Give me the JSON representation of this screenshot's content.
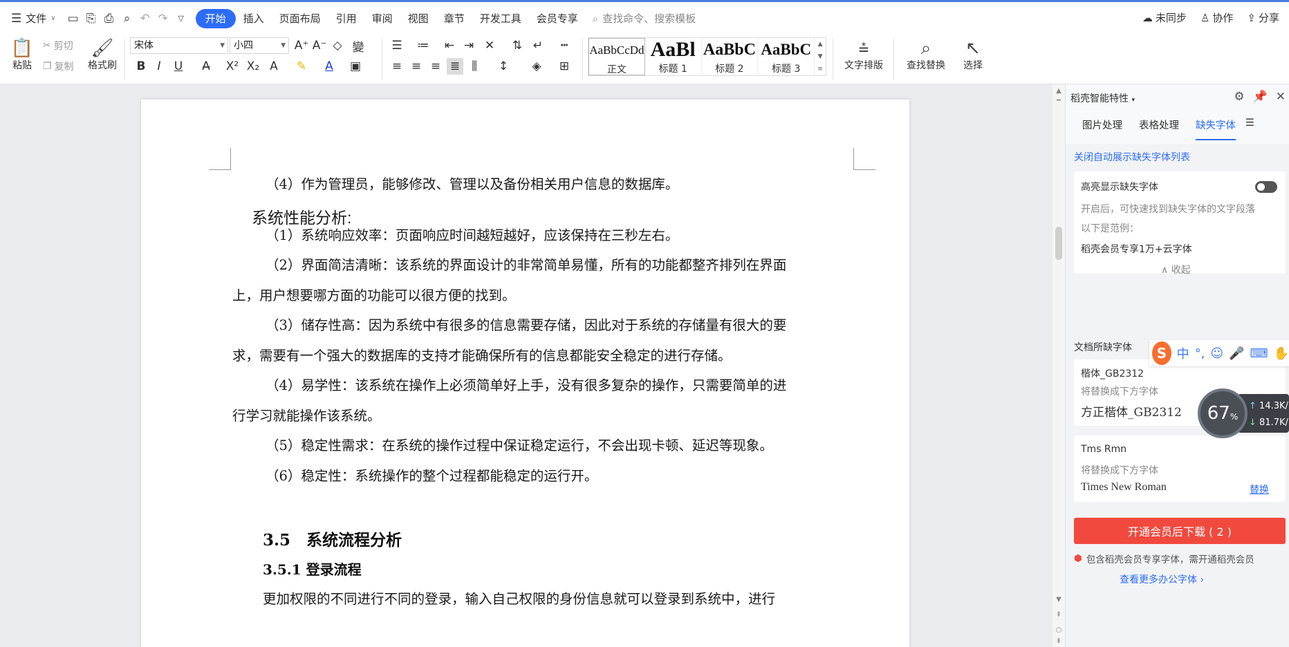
{
  "topbar": {
    "file_menu": "文件",
    "tabs": [
      "开始",
      "插入",
      "页面布局",
      "引用",
      "审阅",
      "视图",
      "章节",
      "开发工具",
      "会员专享"
    ],
    "active_tab": "开始",
    "search_placeholder": "查找命令、搜索模板",
    "right": {
      "sync": "未同步",
      "collab": "协作",
      "share": "分享"
    }
  },
  "ribbon": {
    "paste": "粘贴",
    "cut": "剪切",
    "copy": "复制",
    "format_painter": "格式刷",
    "font_name": "宋体",
    "font_size": "小四",
    "styles": [
      {
        "sample": "AaBbCcDd",
        "name": "正文"
      },
      {
        "sample": "AaBl",
        "name": "标题 1"
      },
      {
        "sample": "AaBbC",
        "name": "标题 2"
      },
      {
        "sample": "AaBbC",
        "name": "标题 3"
      }
    ],
    "text_layout": "文字排版",
    "find_replace": "查找替换",
    "select": "选择"
  },
  "document": {
    "paragraphs": [
      "（4）作为管理员，能够修改、管理以及备份相关用户信息的数据库。",
      "系统性能分析:",
      "（1）系统响应效率：页面响应时间越短越好，应该保持在三秒左右。",
      "（2）界面简洁清晰：该系统的界面设计的非常简单易懂，所有的功能都整齐排列在界面",
      "上，用户想要哪方面的功能可以很方便的找到。",
      "（3）储存性高：因为系统中有很多的信息需要存储，因此对于系统的存储量有很大的要",
      "求，需要有一个强大的数据库的支持才能确保所有的信息都能安全稳定的进行存储。",
      "（4）易学性：该系统在操作上必须简单好上手，没有很多复杂的操作，只需要简单的进",
      "行学习就能操作该系统。",
      "（5）稳定性需求：在系统的操作过程中保证稳定运行，不会出现卡顿、延迟等现象。",
      "（6）稳定性：系统操作的整个过程都能稳定的运行开。",
      "更加权限的不同进行不同的登录，输入自己权限的身份信息就可以登录到系统中，进行"
    ],
    "heading_35": "3.5　系统流程分析",
    "heading_351": "3.5.1 登录流程"
  },
  "panel": {
    "title": "稻壳智能特性",
    "tabs": [
      "图片处理",
      "表格处理",
      "缺失字体"
    ],
    "active_tab": "缺失字体",
    "close_auto_link": "关闭自动展示缺失字体列表",
    "highlight": {
      "title": "高亮显示缺失字体",
      "desc1": "开启后，可快速找到缺失字体的文字段落",
      "desc2": "以下是范例：",
      "example": "稻壳会员专享1万+云字体",
      "collapse": "收起"
    },
    "missing_title": "文档所缺字体",
    "fonts": [
      {
        "name": "楷体_GB2312",
        "hint": "将替换成下方字体",
        "replacement": "方正楷体_GB2312"
      },
      {
        "name": "Tms Rmn",
        "hint": "将替换成下方字体",
        "replacement": "Times New Roman",
        "action": "替换"
      }
    ],
    "download_button": "开通会员后下载 ( 2 )",
    "note": "包含稻壳会员专享字体，需开通稻壳会员",
    "more_link": "查看更多办公字体"
  },
  "overlay": {
    "ime_label": "中",
    "speed_percent": "67",
    "upload_rate": "14.3K/",
    "download_rate": "81.7K/"
  }
}
